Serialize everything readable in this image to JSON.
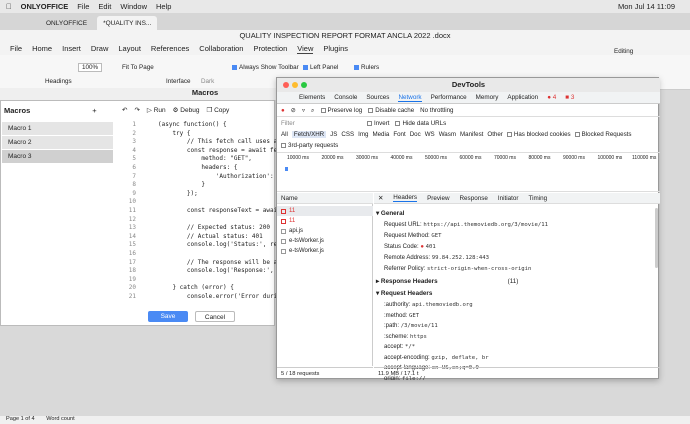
{
  "menubar": {
    "app": "ONLYOFFICE",
    "items": [
      "File",
      "Edit",
      "Window",
      "Help"
    ],
    "clock": "Mon Jul 14  11:09"
  },
  "tabs": [
    "ONLYOFFICE",
    "*QUALITY INS..."
  ],
  "doc_title": "QUALITY INSPECTION REPORT FORMAT ANCLA 2022 .docx",
  "app_menu": [
    "File",
    "Home",
    "Insert",
    "Draw",
    "Layout",
    "References",
    "Collaboration",
    "Protection",
    "View",
    "Plugins"
  ],
  "ribbon": {
    "zoom": "100%",
    "fit_page": "Fit To Page",
    "toolbar": "Always Show Toolbar",
    "left_panel": "Left Panel",
    "rulers": "Rulers",
    "headings": "Headings",
    "interface": "Interface",
    "dark": "Dark",
    "editing": "Editing"
  },
  "macros": {
    "title": "Macros",
    "panel_label": "Macros",
    "items": [
      "Macro 1",
      "Macro 2",
      "Macro 3"
    ],
    "run": "Run",
    "debug": "Debug",
    "copy": "Copy",
    "save": "Save",
    "cancel": "Cancel",
    "code_lines": [
      {
        "n": "1",
        "t": "(async function() {"
      },
      {
        "n": "2",
        "t": "    try {"
      },
      {
        "n": "3",
        "t": "        // This fetch call uses a"
      },
      {
        "n": "4",
        "t": "        const response = await fe"
      },
      {
        "n": "5",
        "t": "            method: \"GET\","
      },
      {
        "n": "6",
        "t": "            headers: {"
      },
      {
        "n": "7",
        "t": "                'Authorization':"
      },
      {
        "n": "8",
        "t": "            }"
      },
      {
        "n": "9",
        "t": "        });"
      },
      {
        "n": "10",
        "t": ""
      },
      {
        "n": "11",
        "t": "        const responseText = awai"
      },
      {
        "n": "12",
        "t": ""
      },
      {
        "n": "13",
        "t": "        // Expected status: 200"
      },
      {
        "n": "14",
        "t": "        // Actual status: 401"
      },
      {
        "n": "15",
        "t": "        console.log('Status:', re"
      },
      {
        "n": "16",
        "t": ""
      },
      {
        "n": "17",
        "t": "        // The response will be a"
      },
      {
        "n": "18",
        "t": "        console.log('Response:', "
      },
      {
        "n": "19",
        "t": ""
      },
      {
        "n": "20",
        "t": "    } catch (error) {"
      },
      {
        "n": "21",
        "t": "        console.error('Error durin"
      }
    ]
  },
  "devtools": {
    "title": "DevTools",
    "tabs": [
      "Elements",
      "Console",
      "Sources",
      "Network",
      "Performance",
      "Memory",
      "Application"
    ],
    "errors": "4",
    "warnings": "3",
    "preserve_log": "Preserve log",
    "disable_cache": "Disable cache",
    "throttling": "No throttling",
    "filter": "Filter",
    "invert": "Invert",
    "hide_data": "Hide data URLs",
    "types": [
      "All",
      "Fetch/XHR",
      "JS",
      "CSS",
      "Img",
      "Media",
      "Font",
      "Doc",
      "WS",
      "Wasm",
      "Manifest",
      "Other"
    ],
    "blocked_cookies": "Has blocked cookies",
    "blocked_requests": "Blocked Requests",
    "third_party": "3rd-party requests",
    "timeline": [
      "10000 ms",
      "20000 ms",
      "30000 ms",
      "40000 ms",
      "50000 ms",
      "60000 ms",
      "70000 ms",
      "80000 ms",
      "90000 ms",
      "100000 ms",
      "110000 ms"
    ],
    "name_header": "Name",
    "requests": [
      "11",
      "11",
      "api.js",
      "e-tsWorker.js",
      "e-tsWorker.js"
    ],
    "detail_tabs": [
      "Headers",
      "Preview",
      "Response",
      "Initiator",
      "Timing"
    ],
    "general_title": "General",
    "general": [
      {
        "k": "Request URL:",
        "v": "https://api.themoviedb.org/3/movie/11"
      },
      {
        "k": "Request Method:",
        "v": "GET"
      },
      {
        "k": "Status Code:",
        "v": "401"
      },
      {
        "k": "Remote Address:",
        "v": "99.84.252.128:443"
      },
      {
        "k": "Referrer Policy:",
        "v": "strict-origin-when-cross-origin"
      }
    ],
    "response_headers": "Response Headers",
    "response_count": "(11)",
    "request_headers": "Request Headers",
    "req_headers": [
      {
        "k": ":authority:",
        "v": "api.themoviedb.org"
      },
      {
        "k": ":method:",
        "v": "GET"
      },
      {
        "k": ":path:",
        "v": "/3/movie/11"
      },
      {
        "k": ":scheme:",
        "v": "https"
      },
      {
        "k": "accept:",
        "v": "*/*"
      },
      {
        "k": "accept-encoding:",
        "v": "gzip, deflate, br"
      },
      {
        "k": "accept-language:",
        "v": "en-US,en;q=0.9"
      },
      {
        "k": "origin:",
        "v": "file://"
      }
    ],
    "status_bar": "5 / 18 requests",
    "transferred": "11.9 MB / 17.1 t"
  },
  "bottom": {
    "page": "Page 1 of 4",
    "words": "Word count"
  },
  "colors": {
    "accent": "#4a8af4",
    "error": "#d33"
  }
}
